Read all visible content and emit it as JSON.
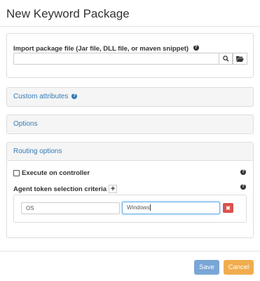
{
  "dialog": {
    "title": "New Keyword Package"
  },
  "import": {
    "label": "Import package file (Jar file, DLL file, or maven snippet)",
    "value": "",
    "search_icon": "search-icon",
    "folder_icon": "folder-open-icon"
  },
  "sections": {
    "custom_attributes": "Custom attributes",
    "options": "Options",
    "routing": "Routing options"
  },
  "routing": {
    "execute_label": "Execute on controller",
    "execute_checked": false,
    "criteria_label": "Agent token selection criteria",
    "add_symbol": "+",
    "criteria": [
      {
        "key": "OS",
        "value": "Windows"
      }
    ],
    "remove_symbol": "✖"
  },
  "footer": {
    "save_label": "Save",
    "cancel_label": "Cancel"
  },
  "colors": {
    "link": "#337ab7",
    "save": "#7aa6d6",
    "cancel": "#f0ad4e",
    "remove": "#d9534f",
    "focus": "#66afe9"
  }
}
